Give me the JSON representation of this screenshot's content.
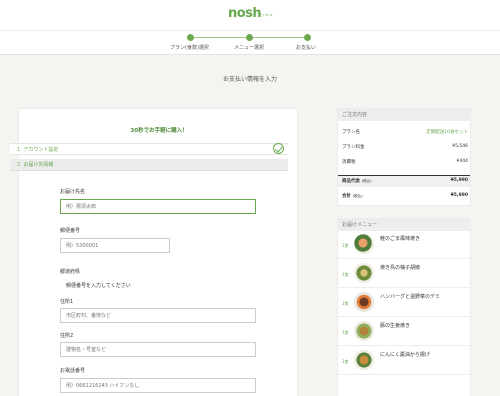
{
  "brand": {
    "logo": "nosh",
    "logo_sub": "ナッシュ"
  },
  "steps": [
    {
      "label": "プラン(食数)選択"
    },
    {
      "label": "メニュー選択"
    },
    {
      "label": "お支払い"
    }
  ],
  "page_title": "お支払い情報を入力",
  "form": {
    "heading": "30秒でお手軽に購入！",
    "step1": {
      "number": "1",
      "label": "アカウント設定"
    },
    "step2": {
      "number": "2",
      "label": "お届け先情報"
    },
    "fields": {
      "name": {
        "label": "お届け先名",
        "placeholder": "例）那須太郎"
      },
      "postal": {
        "label": "郵便番号",
        "placeholder": "例）5300001"
      },
      "prefecture": {
        "label": "都道府県",
        "note": "郵便番号を入力してください"
      },
      "address1": {
        "label": "住所1",
        "placeholder": "市区町村、番地など"
      },
      "address2": {
        "label": "住所2",
        "placeholder": "建物名・号室など"
      },
      "phone": {
        "label": "お電話番号",
        "placeholder": "例）0661216243 ハイフンなし"
      }
    }
  },
  "order_summary": {
    "heading": "ご注文内容",
    "plan_name_label": "プラン名",
    "plan_name_value": "定期配送10食セット",
    "plan_price_label": "プラン料金",
    "plan_price_value": "¥5,546",
    "tax_label": "消費税",
    "tax_value": "¥444",
    "subtotal_label": "商品代金",
    "subtotal_note": "(税込)",
    "subtotal_value": "¥5,990",
    "total_label": "合計",
    "total_note": "(税込)",
    "total_value": "¥5,990"
  },
  "menu": {
    "heading": "お届けメニュー",
    "items": [
      {
        "qty": "1食",
        "name": "鮭のごま風味焼き"
      },
      {
        "qty": "1食",
        "name": "焼き鳥の柚子胡椒"
      },
      {
        "qty": "1食",
        "name": "ハンバーグと温野菜のデミ"
      },
      {
        "qty": "1食",
        "name": "豚の生姜焼き"
      },
      {
        "qty": "1食",
        "name": "にんにく醤油から揚げ"
      }
    ]
  },
  "colors": {
    "accent": "#6aa84f",
    "background": "#f5f4f1"
  },
  "icons": {
    "step_complete": "check-circle-icon"
  }
}
